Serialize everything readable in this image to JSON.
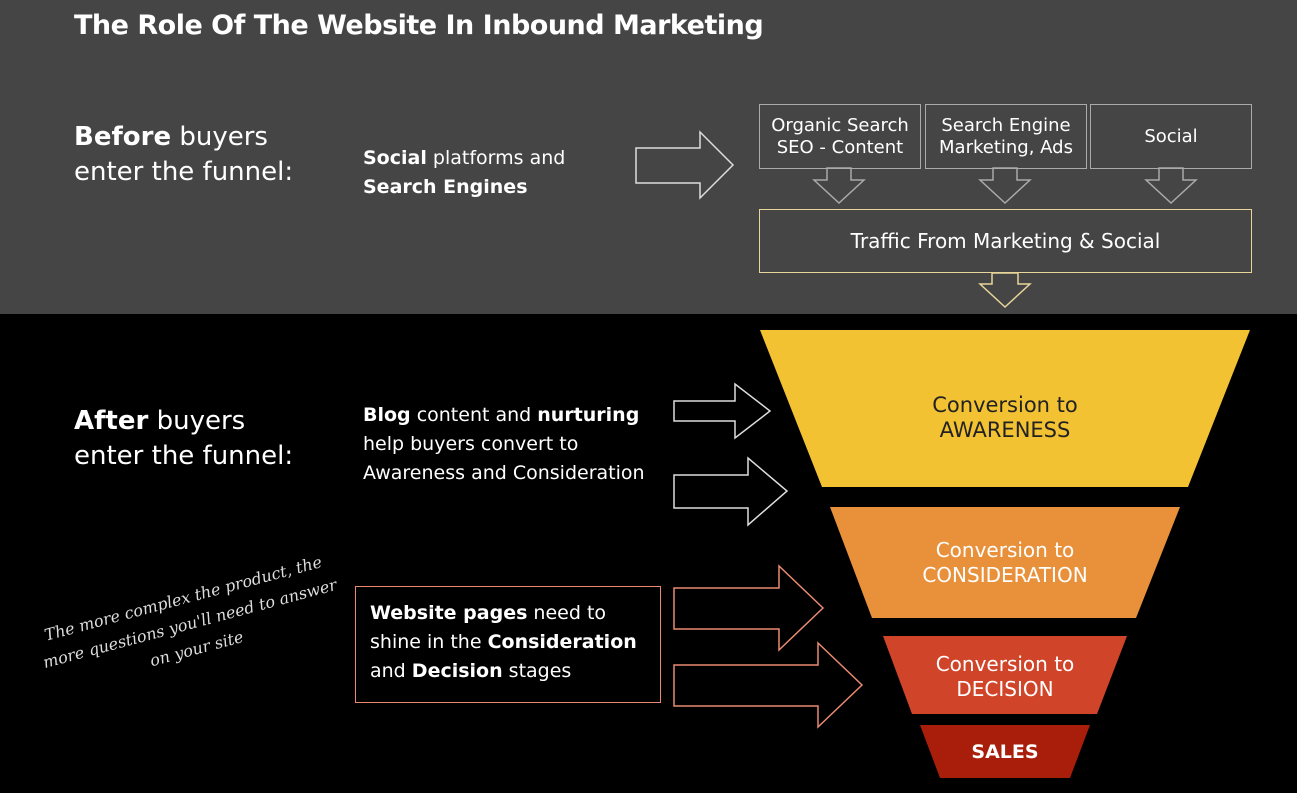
{
  "title": "The Role Of The Website In Inbound Marketing",
  "before": {
    "bold": "Before",
    "rest": " buyers",
    "line2": "enter the funnel:"
  },
  "before_desc": {
    "b1": "Social",
    "t1": " platforms and",
    "b2": "Search Engines"
  },
  "sources": [
    "Organic Search\nSEO - Content",
    "Search Engine\nMarketing, Ads",
    "Social"
  ],
  "traffic": "Traffic From Marketing & Social",
  "after": {
    "bold": "After",
    "rest": " buyers",
    "line2": "enter the funnel:"
  },
  "after_desc": {
    "b1": "Blog",
    "t1": " content and ",
    "b2": "nurturing",
    "l2": "help buyers convert to",
    "l3": "Awareness and Consideration"
  },
  "website_desc": {
    "b1": "Website pages",
    "t1": " need to",
    "l2a": "shine in the ",
    "b2": "Consideration",
    "l3b": "Decision",
    "l3t": " stages",
    "l3a": "and "
  },
  "note": "The more complex the product, the more questions you'll need to answer on your site",
  "funnel": [
    {
      "l1": "Conversion to",
      "l2": "AWARENESS",
      "color": "#f2c233"
    },
    {
      "l1": "Conversion to",
      "l2": "CONSIDERATION",
      "color": "#e8913a"
    },
    {
      "l1": "Conversion to",
      "l2": "DECISION",
      "color": "#d0452a"
    },
    {
      "l1": "SALES",
      "color": "#a81e0a"
    }
  ],
  "colors": {
    "top_bg": "#454545",
    "traffic_border": "#e8d59a",
    "website_border": "#e98a70"
  }
}
